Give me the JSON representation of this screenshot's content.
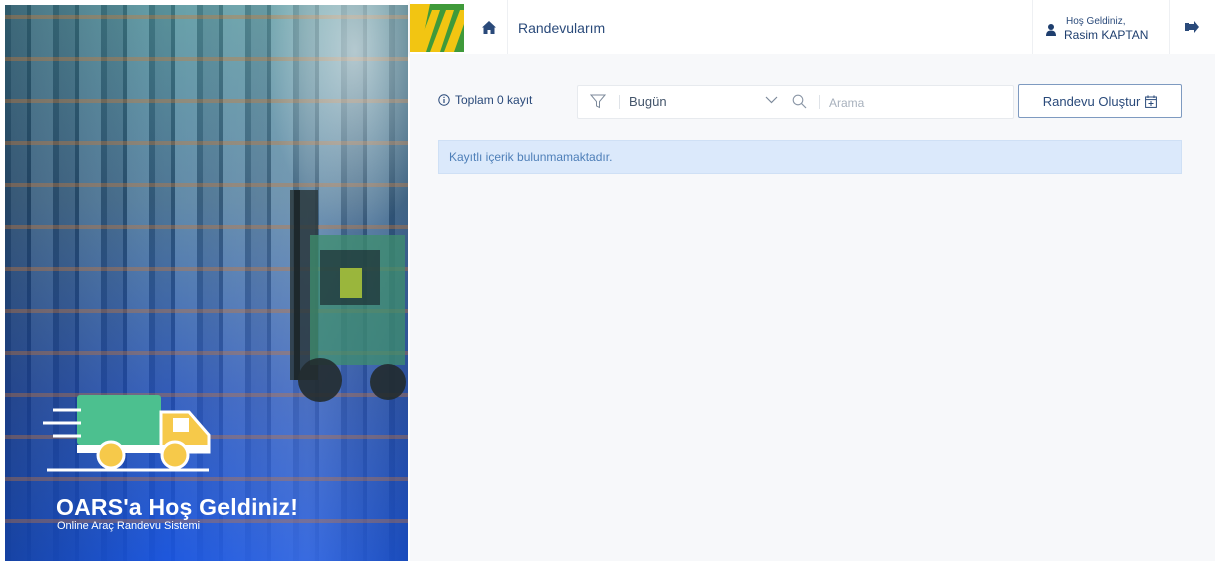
{
  "hero": {
    "title": "OARS'a Hoş Geldiniz!",
    "subtitle": "Online Araç Randevu Sistemi",
    "logo_icon": "delivery-truck-icon",
    "colors": {
      "truck_body": "#4cc08f",
      "truck_cab": "#f6c94a",
      "accent_blue": "#1e5ce0"
    }
  },
  "header": {
    "brand_logo": "brand-logo",
    "home_icon": "home-icon",
    "nav_title": "Randevularım",
    "user": {
      "welcome": "Hoş Geldiniz,",
      "name": "Rasim KAPTAN",
      "icon": "user-icon"
    },
    "logout_icon": "logout-icon",
    "colors": {
      "logo_yellow": "#f2c512",
      "logo_green": "#3f9a3a"
    }
  },
  "toolbar": {
    "total_label": "Toplam 0 kayıt",
    "filter_icon": "filter-icon",
    "date_filter": {
      "selected": "Bugün"
    },
    "search": {
      "value": "",
      "placeholder": "Arama"
    },
    "create_button": "Randevu Oluştur",
    "create_icon": "calendar-plus-icon"
  },
  "content": {
    "empty_message": "Kayıtlı içerik bulunmamaktadır."
  }
}
